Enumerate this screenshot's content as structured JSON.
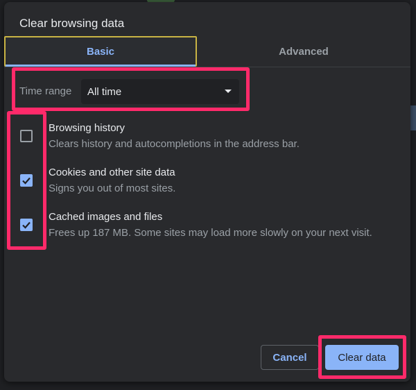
{
  "dialog": {
    "title": "Clear browsing data"
  },
  "tabs": [
    {
      "label": "Basic",
      "selected": true
    },
    {
      "label": "Advanced",
      "selected": false
    }
  ],
  "time_range": {
    "label": "Time range",
    "value": "All time"
  },
  "items": [
    {
      "title": "Browsing history",
      "description": "Clears history and autocompletions in the address bar.",
      "checked": false
    },
    {
      "title": "Cookies and other site data",
      "description": "Signs you out of most sites.",
      "checked": true
    },
    {
      "title": "Cached images and files",
      "description": "Frees up 187 MB. Some sites may load more slowly on your next visit.",
      "checked": true
    }
  ],
  "buttons": {
    "cancel": "Cancel",
    "clear": "Clear data"
  },
  "colors": {
    "accent": "#8ab4f8",
    "highlight": "#ff2a6a",
    "dialog_bg": "#292a2d"
  },
  "icons": {
    "checkbox_checked": "check-icon",
    "dropdown": "chevron-down-icon"
  }
}
